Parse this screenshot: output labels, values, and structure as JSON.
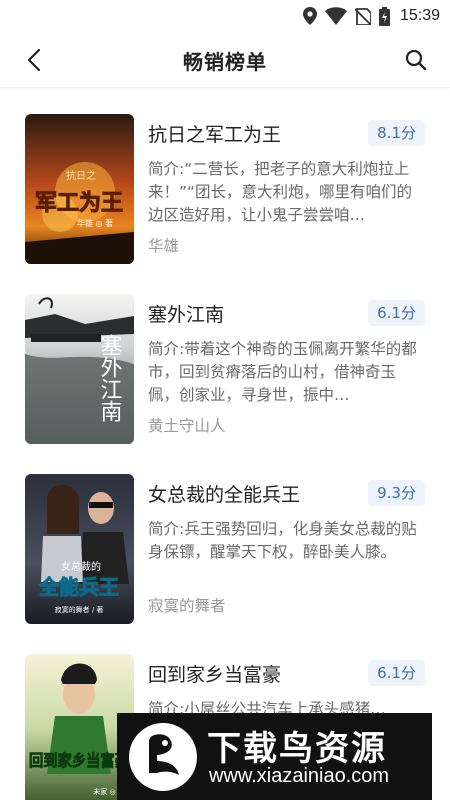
{
  "status_bar": {
    "time": "15:39"
  },
  "header": {
    "title": "畅销榜单"
  },
  "books": [
    {
      "title": "抗日之军工为王",
      "score": "8.1分",
      "description": "简介:“二营长，把老子的意大利炮拉上来！”“团长，意大利炮，哪里有咱们的边区造好用，让小鬼子尝尝咱…",
      "author": "华雄",
      "cover_text": "军工为王",
      "cover_small": "抗日之",
      "cover_author": "华雄 ◎ 著"
    },
    {
      "title": "塞外江南",
      "score": "6.1分",
      "description": "简介:带着这个神奇的玉佩离开繁华的都市，回到贫瘠落后的山村，借神奇玉佩，创家业，寻身世，振中…",
      "author": "黄土守山人",
      "cover_text": "塞外江南"
    },
    {
      "title": "女总裁的全能兵王",
      "score": "9.3分",
      "description": "简介:兵王强势回归，化身美女总裁的贴身保镖，醒掌天下权，醉卧美人膝。",
      "author": "寂寞的舞者",
      "cover_text": "全能兵王",
      "cover_small": "女总裁的",
      "cover_author": "寂寞的舞者 / 著"
    },
    {
      "title": "回到家乡当富豪",
      "score": "6.1分",
      "description": "简介:小屌丝公共汽车上承头感猪…",
      "author": "未家",
      "cover_text": "回到家乡当富豪",
      "cover_author": "未家 ◎ 著"
    }
  ],
  "watermark": {
    "title": "下载鸟资源",
    "url": "www.xiazainiao.com"
  },
  "colors": {
    "score_bg": "#eef3fb",
    "score_text": "#3f6fb5",
    "watermark_bg": "#111111"
  },
  "icons": [
    "location-icon",
    "wifi-icon",
    "no-sim-icon",
    "battery-icon",
    "back-arrow-icon",
    "search-icon",
    "bird-logo-icon"
  ]
}
